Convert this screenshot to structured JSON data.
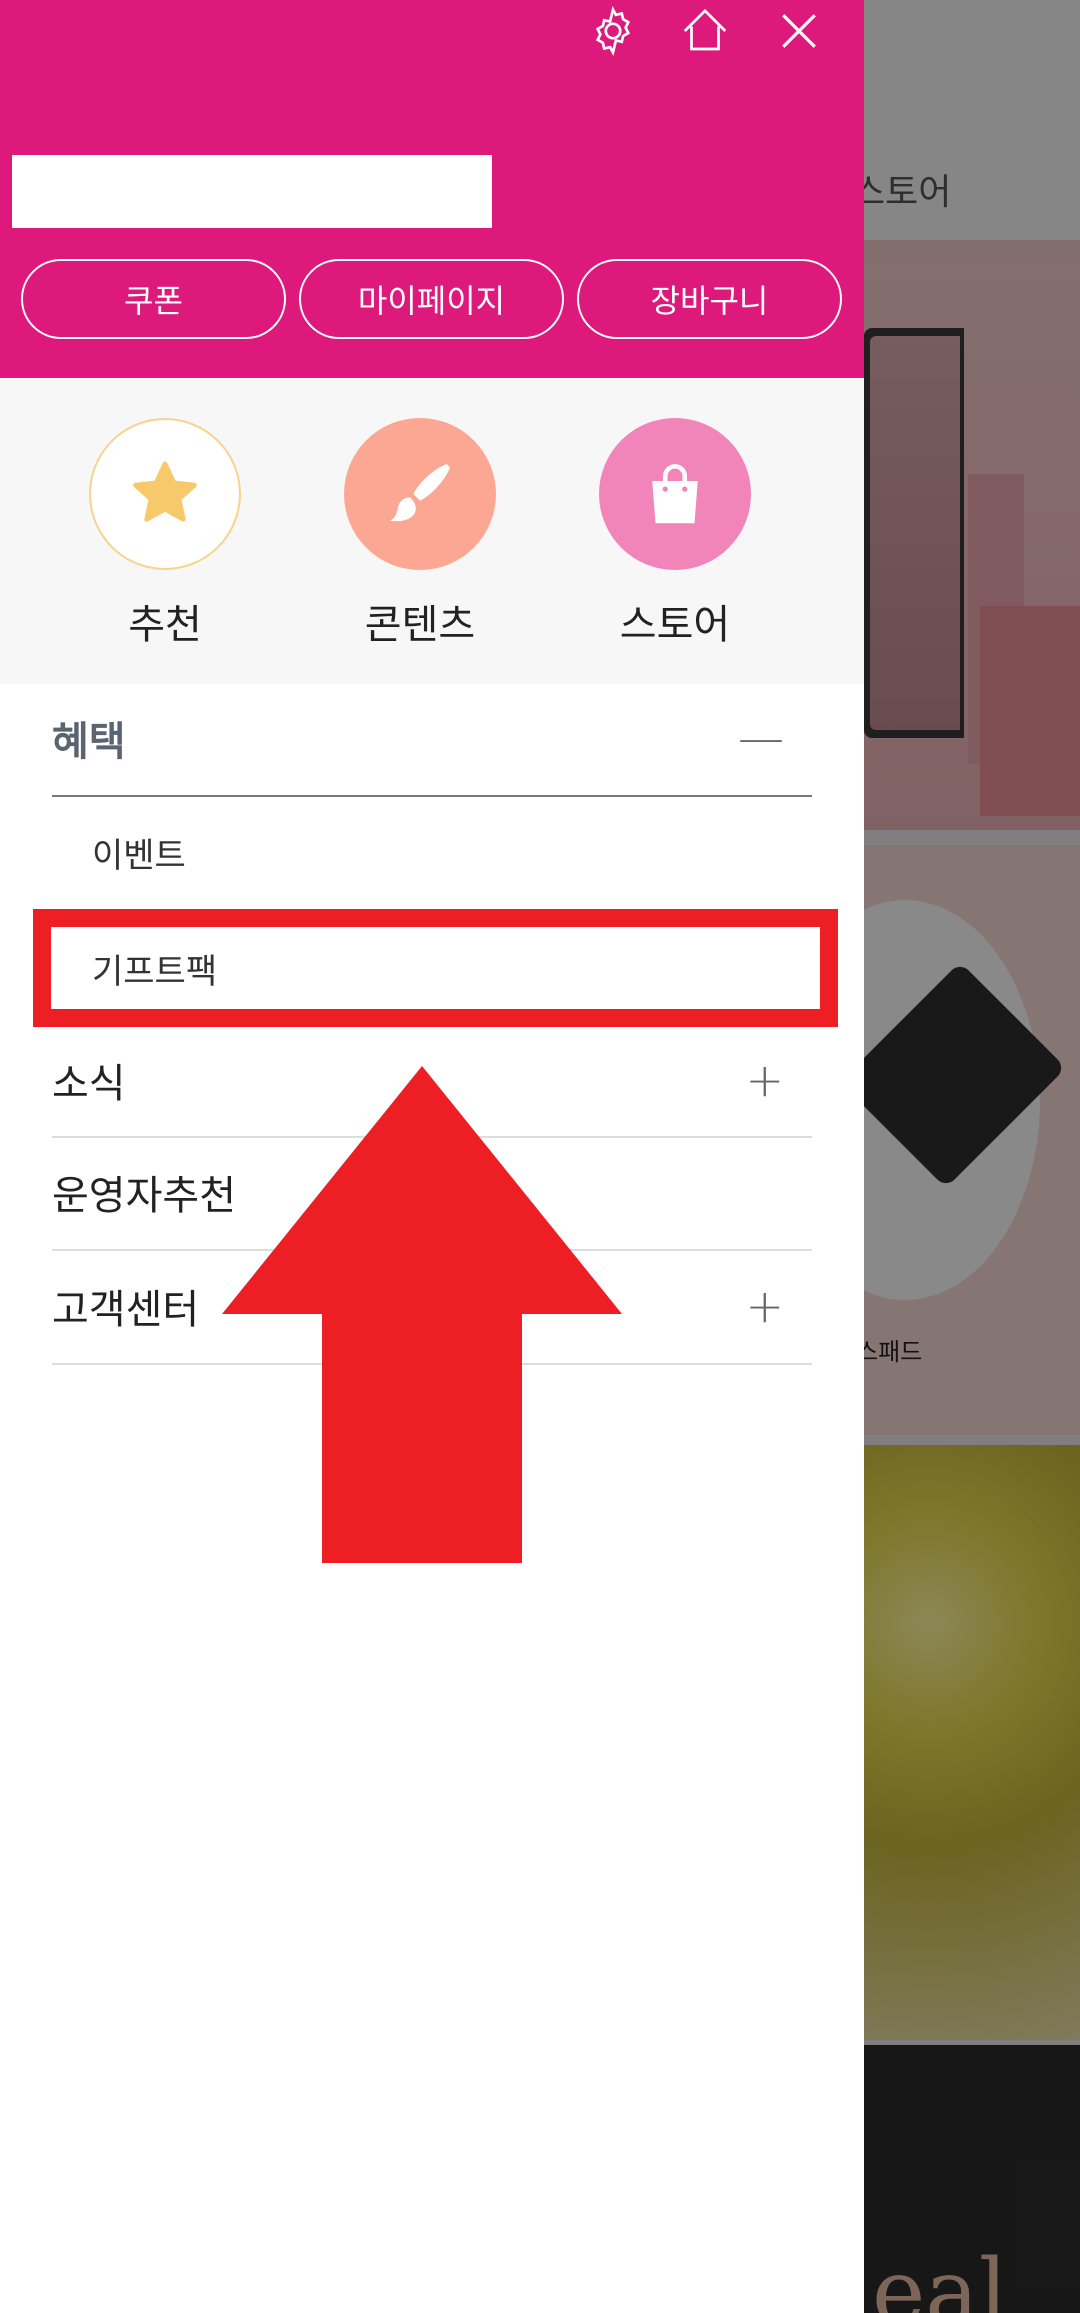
{
  "background": {
    "nav_text": "스토어",
    "product_caption": "스패드",
    "banner_text": "eal"
  },
  "header": {
    "icons": [
      "settings-gear-icon",
      "home-icon",
      "close-icon"
    ],
    "buttons": {
      "coupon": "쿠폰",
      "mypage": "마이페이지",
      "cart": "장바구니"
    },
    "brand_color": "#dd1a7c"
  },
  "categories": [
    {
      "label": "추천",
      "icon": "star-icon"
    },
    {
      "label": "콘텐츠",
      "icon": "brush-icon"
    },
    {
      "label": "스토어",
      "icon": "shopping-bag-icon"
    }
  ],
  "menu": {
    "benefits": {
      "title": "혜택",
      "toggle": "—"
    },
    "benefits_items": [
      "이벤트",
      "기프트팩"
    ],
    "news": {
      "title": "소식",
      "toggle": "+"
    },
    "operator_pick": {
      "title": "운영자추천"
    },
    "customer_center": {
      "title": "고객센터",
      "toggle": "+"
    }
  },
  "annotation": {
    "highlight_color": "#ee1e25"
  }
}
